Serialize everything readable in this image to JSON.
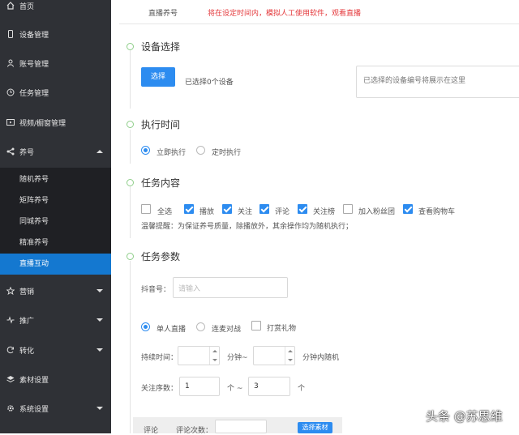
{
  "sidebar": {
    "items": [
      {
        "label": "首页",
        "icon": "home-icon"
      },
      {
        "label": "设备管理",
        "icon": "phone-icon"
      },
      {
        "label": "账号管理",
        "icon": "user-icon"
      },
      {
        "label": "任务管理",
        "icon": "clock-icon"
      },
      {
        "label": "视频/橱窗管理",
        "icon": "video-icon"
      },
      {
        "label": "养号",
        "icon": "share-icon"
      },
      {
        "label": "营销",
        "icon": "star-icon"
      },
      {
        "label": "推广",
        "icon": "pulse-icon"
      },
      {
        "label": "转化",
        "icon": "refresh-icon"
      },
      {
        "label": "素材设置",
        "icon": "layers-icon"
      },
      {
        "label": "系统设置",
        "icon": "gear-icon"
      }
    ],
    "submenu": [
      {
        "label": "随机养号"
      },
      {
        "label": "矩阵养号"
      },
      {
        "label": "同城养号"
      },
      {
        "label": "精准养号"
      },
      {
        "label": "直播互动",
        "active": true
      }
    ],
    "bg_color": "#2f3136",
    "active_color": "#1478d0"
  },
  "header": {
    "tab": "直播养号",
    "notice": "将在设定时间内，模拟人工使用软件，观看直播",
    "notice_color": "#e4393c"
  },
  "device": {
    "title": "设备选择",
    "select_button": "选择",
    "selected_count": "已选择0个设备",
    "box_placeholder": "已选择的设备编号将展示在这里"
  },
  "exec_time": {
    "title": "执行时间",
    "options": [
      {
        "label": "立即执行",
        "selected": true
      },
      {
        "label": "定时执行",
        "selected": false
      }
    ]
  },
  "task_content": {
    "title": "任务内容",
    "checkboxes": [
      {
        "label": "全选",
        "checked": false
      },
      {
        "label": "播放",
        "checked": true
      },
      {
        "label": "关注",
        "checked": true
      },
      {
        "label": "评论",
        "checked": true
      },
      {
        "label": "关注榜",
        "checked": true
      },
      {
        "label": "加入粉丝团",
        "checked": false
      },
      {
        "label": "查看购物车",
        "checked": true
      }
    ],
    "tip": "温馨提醒：为保证养号质量，除播放外，其余操作均为随机执行；"
  },
  "params": {
    "title": "任务参数",
    "douyin_label": "抖音号：",
    "douyin_placeholder": "请输入",
    "mode_options": [
      {
        "label": "单人直播",
        "selected": true
      },
      {
        "label": "连麦对战",
        "selected": false
      }
    ],
    "gift_label": "打赏礼物",
    "gift_checked": false,
    "duration_label": "持续时间：",
    "minute_sep": "分钟~",
    "minute_suffix": "分钟内随机",
    "follow_label": "关注序数：",
    "follow_from": "1",
    "follow_sep": "个 ~",
    "follow_to": "3",
    "follow_suffix": "个"
  },
  "comment": {
    "label": "评论",
    "count_label": "评论次数：",
    "select_button": "选择素材"
  },
  "watermark": "头条 @苏思维",
  "accent_color": "#2d8cf0"
}
